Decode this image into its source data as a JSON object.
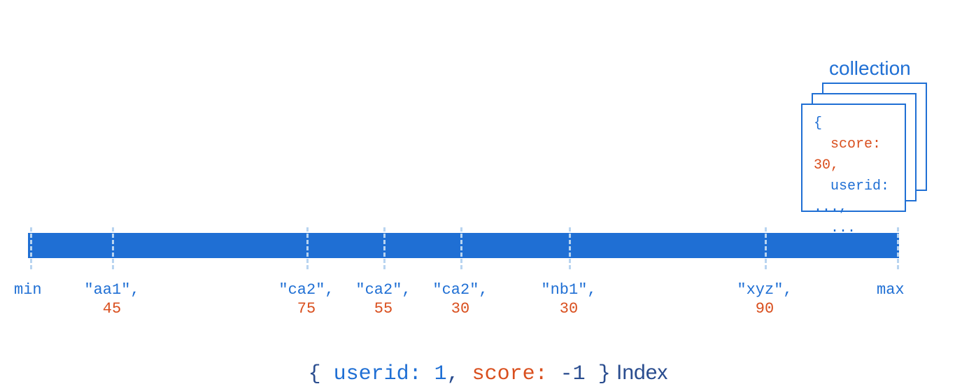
{
  "collection": {
    "label": "collection",
    "document": {
      "open_brace": "{",
      "score_key": "score:",
      "score_val": " 30,",
      "userid_key": "userid:",
      "userid_val": " ...,",
      "dots": "...",
      "close_brace": "}"
    }
  },
  "bar": {
    "min": "min",
    "max": "max",
    "entries": [
      {
        "pos": 160,
        "id": "\"aa1\",",
        "score": "45"
      },
      {
        "pos": 438,
        "id": "\"ca2\",",
        "score": "75"
      },
      {
        "pos": 548,
        "id": "\"ca2\",",
        "score": "55"
      },
      {
        "pos": 658,
        "id": "\"ca2\",",
        "score": "30"
      },
      {
        "pos": 813,
        "id": "\"nb1\",",
        "score": "30"
      },
      {
        "pos": 1093,
        "id": "\"xyz\",",
        "score": "90"
      }
    ]
  },
  "index": {
    "open": "{ ",
    "userid_k": "userid:",
    "userid_v": " 1",
    "comma": ", ",
    "score_k": "score:",
    "score_v": " -1",
    "close": " }",
    "label": " Index"
  }
}
